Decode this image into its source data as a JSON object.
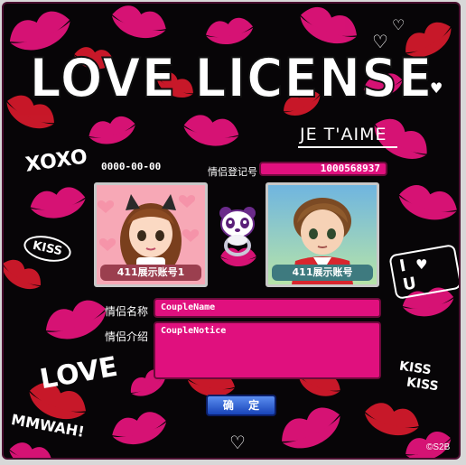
{
  "title": "LOVE LICENSE",
  "subtitle": "JE T'AIME",
  "doodles": {
    "xoxo": "XOXO",
    "kiss": "KISS",
    "love": "LOVE",
    "mwah": "MMWAH!",
    "i_u": "I U",
    "kiss_kiss_1": "KISS",
    "kiss_kiss_2": "KISS"
  },
  "date": "0000-00-00",
  "registration": {
    "label": "情侣登记号",
    "value": "1000568937"
  },
  "partners": [
    {
      "account": "411展示账号1"
    },
    {
      "account": "411展示账号"
    }
  ],
  "fields": {
    "name_label": "情侣名称",
    "name_value": "CoupleName",
    "notice_label": "情侣介绍",
    "notice_value": "CoupleNotice"
  },
  "confirm_label": "确 定",
  "copyright": "©S2B",
  "colors": {
    "panel": "#070507",
    "pink_field": "#e0107e",
    "kiss_pink": "#e8147e",
    "kiss_red": "#d81a2c",
    "button_blue": "#1f4fc8"
  },
  "icons": {
    "panda": "panda-mascot-icon",
    "heart": "heart-icon"
  }
}
